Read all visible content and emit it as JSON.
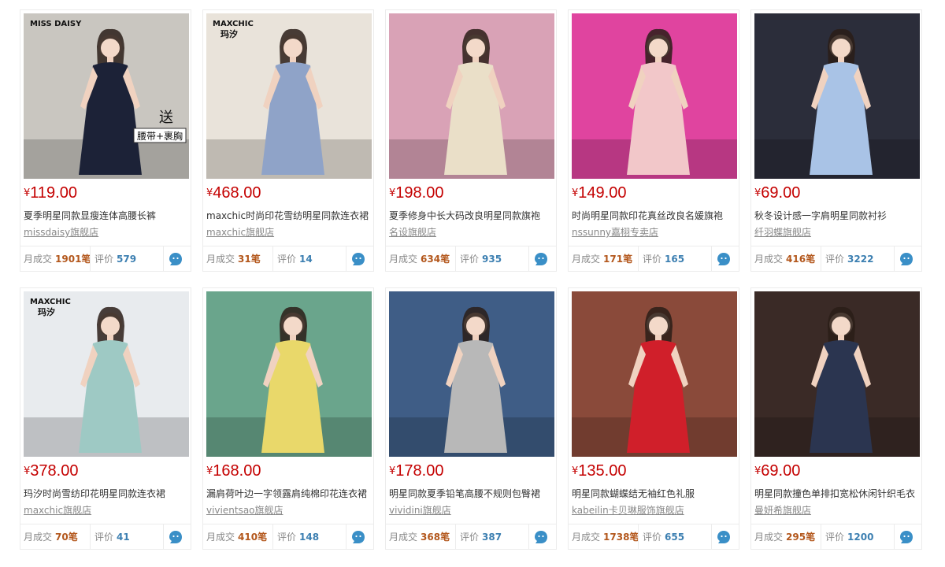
{
  "labels": {
    "currency": "¥",
    "monthly_sales": "月成交",
    "reviews": "评价"
  },
  "colors": {
    "price": "#c40000",
    "sales_number": "#b3571c",
    "review_number": "#3c7fb1",
    "chat_icon": "#3a8fc7"
  },
  "products": [
    {
      "price": "119.00",
      "title": "夏季明星同款显瘦连体高腰长裤",
      "shop": "missdaisy旗舰店",
      "sales": "1901笔",
      "reviews": "579",
      "photo": {
        "bg": "#c9c6c0",
        "outfit": "#1c2237",
        "brand": "MISS DAISY",
        "promo_line1": "送",
        "promo_line2": "腰带+裹胸"
      }
    },
    {
      "price": "468.00",
      "title": "maxchic时尚印花雪纺明星同款连衣裙",
      "shop": "maxchic旗舰店",
      "sales": "31笔",
      "reviews": "14",
      "photo": {
        "bg": "#e9e3da",
        "outfit": "#8fa3c8",
        "brand": "MAXCHIC",
        "brand_sub": "玛汐"
      }
    },
    {
      "price": "198.00",
      "title": "夏季修身中长大码改良明星同款旗袍",
      "shop": "名设旗舰店",
      "sales": "634笔",
      "reviews": "935",
      "photo": {
        "bg": "#d9a2b6",
        "outfit": "#eadfc8"
      }
    },
    {
      "price": "149.00",
      "title": "时尚明星同款印花真丝改良名媛旗袍",
      "shop": "nssunny嘉栩专卖店",
      "sales": "171笔",
      "reviews": "165",
      "photo": {
        "bg": "#e0449f",
        "outfit": "#f2c7c9"
      }
    },
    {
      "price": "69.00",
      "title": "秋冬设计感一字肩明星同款衬衫",
      "shop": "纤羽蝶旗舰店",
      "sales": "416笔",
      "reviews": "3222",
      "photo": {
        "bg": "#2b2d3a",
        "outfit": "#a9c3e6"
      }
    },
    {
      "price": "378.00",
      "title": "玛汐时尚雪纺印花明星同款连衣裙",
      "shop": "maxchic旗舰店",
      "sales": "70笔",
      "reviews": "41",
      "photo": {
        "bg": "#e8ebee",
        "outfit": "#9ec9c4",
        "brand": "MAXCHIC",
        "brand_sub": "玛汐"
      }
    },
    {
      "price": "168.00",
      "title": "漏肩荷叶边一字领露肩纯棉印花连衣裙",
      "shop": "vivientsao旗舰店",
      "sales": "410笔",
      "reviews": "148",
      "photo": {
        "bg": "#6aa58c",
        "outfit": "#e9d86a"
      }
    },
    {
      "price": "178.00",
      "title": "明星同款夏季铅笔高腰不规则包臀裙",
      "shop": "vividini旗舰店",
      "sales": "368笔",
      "reviews": "387",
      "photo": {
        "bg": "#3f5d86",
        "outfit": "#b8b8b8"
      }
    },
    {
      "price": "135.00",
      "title": "明星同款蝴蝶结无袖红色礼服",
      "shop": "kabeilin卡贝琳服饰旗舰店",
      "sales": "1738笔",
      "reviews": "655",
      "photo": {
        "bg": "#8a4a3a",
        "outfit": "#d01f2a"
      }
    },
    {
      "price": "69.00",
      "title": "明星同款撞色单排扣宽松休闲针织毛衣",
      "shop": "曼妍希旗舰店",
      "sales": "295笔",
      "reviews": "1200",
      "photo": {
        "bg": "#3a2a26",
        "outfit": "#2b3550"
      }
    }
  ]
}
